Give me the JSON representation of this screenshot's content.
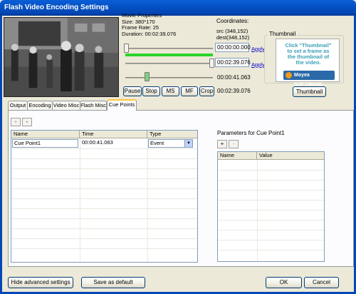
{
  "window": {
    "title": "Flash Video Encoding Settings"
  },
  "movie_properties": {
    "heading": "Movie Properties",
    "size": "Size: 380*170",
    "frame_rate": "Frame Rate: 25",
    "duration": "Duration: 00:02:39.076"
  },
  "coordinates": {
    "heading": "Coordinates:",
    "src": "src (348,152)",
    "dest": "dest(348,152)"
  },
  "trim": {
    "start_time": "00:00:00.000",
    "end_time": "00:02:39.076",
    "apply_label": "Apply",
    "current_time": "00:00:41.063",
    "position_time": "00:02:39.076",
    "current_position": 0.26
  },
  "playback_buttons": {
    "pause": "Pause",
    "stop": "Stop",
    "ms": "MS",
    "mf": "MF",
    "crop": "Crop"
  },
  "thumbnail": {
    "group_label": "Thumbnail",
    "message": "Click \"Thumbnail\" to set a frame as the thumbnail of the video.",
    "logo_text": "Moyea SOFTWARE",
    "button_label": "Thumbnail"
  },
  "tabs": [
    {
      "label": "Output",
      "active": false
    },
    {
      "label": "Encoding",
      "active": false
    },
    {
      "label": "Video Misc",
      "active": false
    },
    {
      "label": "Flash Misc",
      "active": false
    },
    {
      "label": "Cue Points",
      "active": true
    }
  ],
  "cue_points": {
    "add_label": "+",
    "remove_label": "-",
    "columns": [
      "Name",
      "Time",
      "Type"
    ],
    "rows": [
      {
        "name": "Cue Point1",
        "time": "00:00:41.063",
        "type": "Event"
      }
    ]
  },
  "parameters": {
    "heading": "Parameters for Cue Point1",
    "add_label": "+",
    "remove_label": "-",
    "columns": [
      "Name",
      "Value"
    ]
  },
  "footer": {
    "hide_advanced": "Hide advanced settings",
    "save_default": "Save as default",
    "ok": "OK",
    "cancel": "Cancel"
  },
  "colors": {
    "title_bar": "#0447b6",
    "progress": "#2ad42a",
    "link": "#0000cc",
    "thumbnail_text": "#3aa0b8"
  }
}
